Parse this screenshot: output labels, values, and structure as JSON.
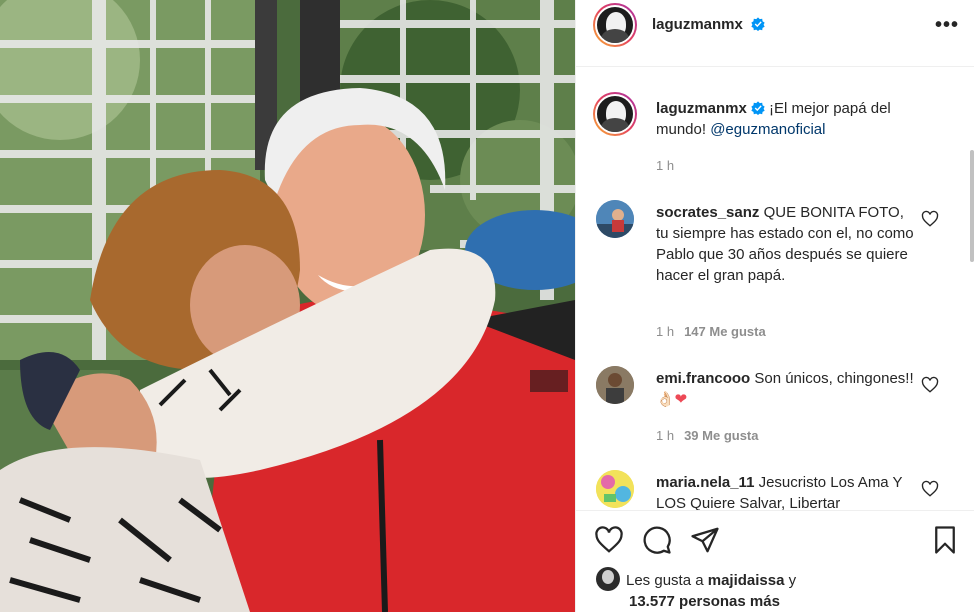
{
  "post": {
    "username": "laguzmanmx",
    "more_label": "•••",
    "caption": {
      "username": "laguzmanmx",
      "text": "¡El mejor papá del mundo! ",
      "mention": "@eguzmanoficial",
      "time": "1 h"
    }
  },
  "comments": [
    {
      "username": "socrates_sanz",
      "text": "QUE BONITA FOTO, tu siempre has estado con el, no como Pablo que 30 años después se quiere hacer el gran papá.",
      "time": "1 h",
      "likes": "147 Me gusta"
    },
    {
      "username": "emi.francooo",
      "text": "Son únicos, chingones!!",
      "emoji": "👌🏻❤",
      "time": "1 h",
      "likes": "39 Me gusta"
    },
    {
      "username": "maria.nela_11",
      "text": "Jesucristo Los Ama Y LOS Quiere Salvar, Libertar"
    }
  ],
  "likes_summary": {
    "prefix": "Les gusta a",
    "user": "majidaissa",
    "conj": "y",
    "count": "13.577 personas más"
  },
  "icons": {
    "like": "heart-icon",
    "comment": "comment-icon",
    "share": "share-icon",
    "save": "bookmark-icon",
    "verified": "verified-badge-icon"
  },
  "colors": {
    "text": "#262626",
    "muted": "#8e8e8e",
    "mention": "#00376b",
    "verified": "#0095f6",
    "heart_red": "#ed4956"
  }
}
